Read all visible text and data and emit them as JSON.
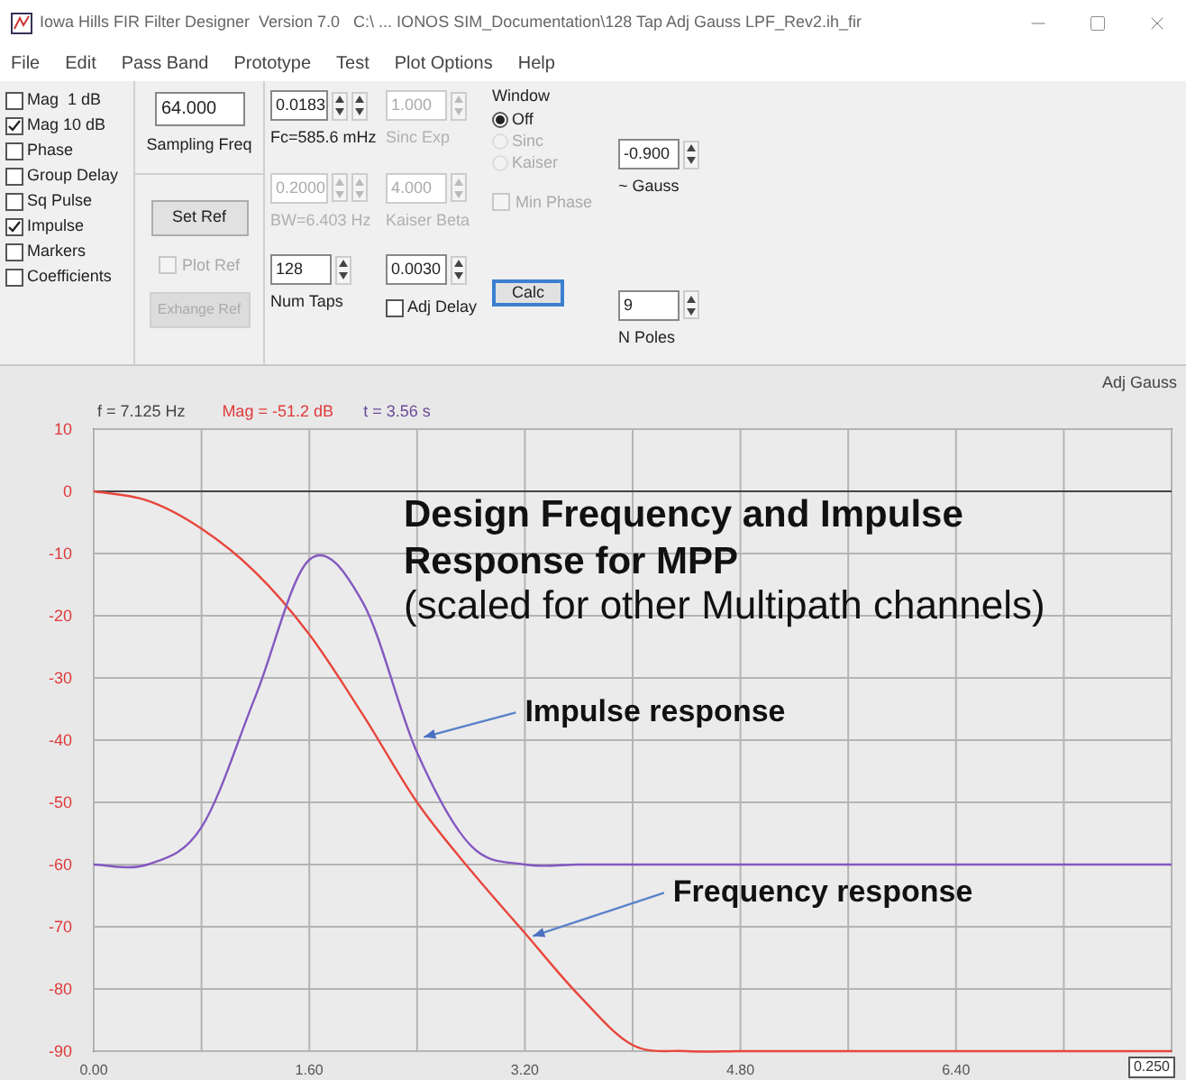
{
  "window": {
    "title": "Iowa Hills FIR Filter Designer  Version 7.0   C:\\ ... IONOS SIM_Documentation\\128 Tap Adj Gauss LPF_Rev2.ih_fir"
  },
  "menu": [
    "File",
    "Edit",
    "Pass Band",
    "Prototype",
    "Test",
    "Plot Options",
    "Help"
  ],
  "plot_checks": [
    {
      "label": "Mag  1 dB",
      "checked": false
    },
    {
      "label": "Mag 10 dB",
      "checked": true
    },
    {
      "label": "Phase",
      "checked": false
    },
    {
      "label": "Group Delay",
      "checked": false
    },
    {
      "label": "Sq Pulse",
      "checked": false
    },
    {
      "label": "Impulse",
      "checked": true
    },
    {
      "label": "Markers",
      "checked": false
    },
    {
      "label": "Coefficients",
      "checked": false
    }
  ],
  "sampling_freq": {
    "value": "64.000",
    "label": "Sampling Freq"
  },
  "set_ref": {
    "label": "Set Ref",
    "disabled": false
  },
  "plot_ref": {
    "label": "Plot Ref",
    "checked": false,
    "disabled": true
  },
  "exchange_ref": {
    "label": "Exhange Ref",
    "disabled": true
  },
  "field_columns": [
    [
      {
        "value": "0.0183",
        "kind": "double",
        "label": "Fc=585.6 mHz",
        "disabled": false
      },
      {
        "value": "0.2000",
        "kind": "double",
        "label": "BW=6.403 Hz",
        "disabled": true
      },
      {
        "value": "128",
        "kind": "single",
        "label": "Num Taps",
        "disabled": false
      }
    ],
    [
      {
        "value": "1.000",
        "kind": "single",
        "label": "Sinc Exp",
        "disabled": true
      },
      {
        "value": "4.000",
        "kind": "single",
        "label": "Kaiser Beta",
        "disabled": true
      },
      {
        "value": "0.0030",
        "kind": "single",
        "checkbox": {
          "label": "Adj Delay",
          "checked": false
        },
        "disabled": false
      }
    ]
  ],
  "window_group": {
    "title": "Window",
    "options": [
      {
        "label": "Off",
        "selected": true,
        "disabled": false
      },
      {
        "label": "Sinc",
        "selected": false,
        "disabled": true
      },
      {
        "label": "Kaiser",
        "selected": false,
        "disabled": true
      }
    ],
    "min_phase": {
      "label": "Min Phase",
      "checked": false,
      "disabled": true
    },
    "calc": {
      "label": "Calc"
    }
  },
  "gauss": {
    "value": "-0.900",
    "label": "~ Gauss"
  },
  "poles": {
    "value": "9",
    "label": "N Poles"
  },
  "plot": {
    "caption": "Adj Gauss",
    "readouts": [
      {
        "text": "f = 7.125 Hz",
        "color": "#444444"
      },
      {
        "text": "Mag = -51.2 dB",
        "color": "#e03a3a"
      },
      {
        "text": "t = 3.56 s",
        "color": "#6a4a9a"
      }
    ],
    "range_field": "0.250",
    "chart_data": {
      "type": "line",
      "x": [
        0,
        0.4,
        0.8,
        1.2,
        1.6,
        2.0,
        2.4,
        2.8,
        3.2,
        3.6,
        4.0,
        4.4,
        4.8,
        5.2,
        5.6,
        6.0,
        6.4,
        6.8,
        7.2,
        7.6,
        8.0
      ],
      "series": [
        {
          "color": "#e8463c",
          "values": [
            0,
            -1.5,
            -6,
            -13,
            -23,
            -36,
            -50,
            -61,
            -71,
            -81,
            -89,
            -90,
            -90,
            -90,
            -90,
            -90,
            -90,
            -90,
            -90,
            -90,
            -90
          ]
        },
        {
          "color": "#8458c0",
          "values": [
            -60,
            -60,
            -54,
            -33,
            -11,
            -18,
            -42,
            -57,
            -60,
            -60,
            -60,
            -60,
            -60,
            -60,
            -60,
            -60,
            -60,
            -60,
            -60,
            -60,
            -60
          ]
        }
      ],
      "xlim": [
        0,
        8
      ],
      "ylim": [
        -90,
        10
      ],
      "grid": true,
      "xticks": [
        {
          "value": 0,
          "label": "0.00"
        },
        {
          "value": 1.6,
          "label": "1.60"
        },
        {
          "value": 3.2,
          "label": "3.20"
        },
        {
          "value": 4.8,
          "label": "4.80"
        },
        {
          "value": 6.4,
          "label": "6.40"
        }
      ],
      "yticks": [
        10,
        0,
        -10,
        -20,
        -30,
        -40,
        -50,
        -60,
        -70,
        -80,
        -90
      ]
    },
    "headline": [
      "Design Frequency and Impulse",
      "Response for MPP"
    ],
    "note": "(scaled for other Multipath channels)",
    "callouts": [
      {
        "text": "Impulse response"
      },
      {
        "text": "Frequency response"
      }
    ]
  }
}
